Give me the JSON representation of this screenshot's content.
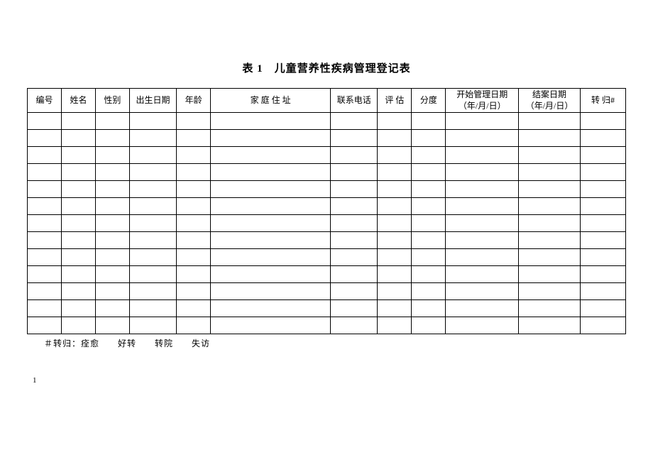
{
  "title": "表 1　儿童营养性疾病管理登记表",
  "headers": {
    "col1": "编号",
    "col2": "姓名",
    "col3": "性别",
    "col4": "出生日期",
    "col5": "年龄",
    "col6": "家 庭 住 址",
    "col7": "联系电话",
    "col8": "评 估",
    "col9": "分度",
    "col10_line1": "开始管理日期",
    "col10_line2": "（年/月/日）",
    "col11_line1": "结案日期",
    "col11_line2": "（年/月/日）",
    "col12": "转 归#"
  },
  "footnote": "＃转归：痊愈　　好转　　转院　　失访",
  "pagenum": "1"
}
